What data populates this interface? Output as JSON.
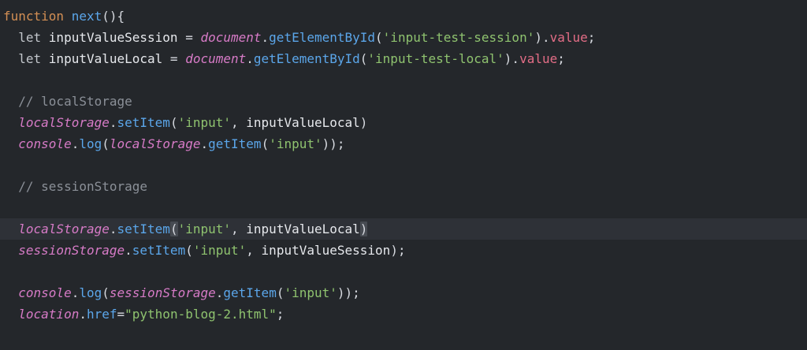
{
  "editor": {
    "theme_colors": {
      "background": "#24272b",
      "active_line": "#2e3137",
      "keyword": "#d38f54",
      "function": "#5ba6ea",
      "builtin_italic": "#d77bc7",
      "string": "#8fc36f",
      "comment": "#8b9098"
    },
    "active_line_index": 10,
    "lines": [
      {
        "tokens": [
          {
            "t": "function ",
            "c": "keyword"
          },
          {
            "t": "next",
            "c": "func"
          },
          {
            "t": "(){",
            "c": "punct"
          }
        ]
      },
      {
        "tokens": [
          {
            "t": "  let ",
            "c": "let"
          },
          {
            "t": "inputValueSession",
            "c": "ident"
          },
          {
            "t": " = ",
            "c": "punct"
          },
          {
            "t": "document",
            "c": "italic"
          },
          {
            "t": ".",
            "c": "punct"
          },
          {
            "t": "getElementById",
            "c": "func"
          },
          {
            "t": "(",
            "c": "punct"
          },
          {
            "t": "'input-test-session'",
            "c": "string"
          },
          {
            "t": ").",
            "c": "punct"
          },
          {
            "t": "value",
            "c": "prop"
          },
          {
            "t": ";",
            "c": "punct"
          }
        ]
      },
      {
        "tokens": [
          {
            "t": "  let ",
            "c": "let"
          },
          {
            "t": "inputValueLocal",
            "c": "ident"
          },
          {
            "t": " = ",
            "c": "punct"
          },
          {
            "t": "document",
            "c": "italic"
          },
          {
            "t": ".",
            "c": "punct"
          },
          {
            "t": "getElementById",
            "c": "func"
          },
          {
            "t": "(",
            "c": "punct"
          },
          {
            "t": "'input-test-local'",
            "c": "string"
          },
          {
            "t": ").",
            "c": "punct"
          },
          {
            "t": "value",
            "c": "prop"
          },
          {
            "t": ";",
            "c": "punct"
          }
        ]
      },
      {
        "tokens": []
      },
      {
        "tokens": [
          {
            "t": "  // localStorage",
            "c": "comment"
          }
        ]
      },
      {
        "tokens": [
          {
            "t": "  ",
            "c": "punct"
          },
          {
            "t": "localStorage",
            "c": "italic"
          },
          {
            "t": ".",
            "c": "punct"
          },
          {
            "t": "setItem",
            "c": "func"
          },
          {
            "t": "(",
            "c": "punct"
          },
          {
            "t": "'input'",
            "c": "string"
          },
          {
            "t": ", ",
            "c": "punct"
          },
          {
            "t": "inputValueLocal",
            "c": "ident"
          },
          {
            "t": ")",
            "c": "punct"
          }
        ]
      },
      {
        "tokens": [
          {
            "t": "  ",
            "c": "punct"
          },
          {
            "t": "console",
            "c": "italic"
          },
          {
            "t": ".",
            "c": "punct"
          },
          {
            "t": "log",
            "c": "func"
          },
          {
            "t": "(",
            "c": "punct"
          },
          {
            "t": "localStorage",
            "c": "italic"
          },
          {
            "t": ".",
            "c": "punct"
          },
          {
            "t": "getItem",
            "c": "func"
          },
          {
            "t": "(",
            "c": "punct"
          },
          {
            "t": "'input'",
            "c": "string"
          },
          {
            "t": "));",
            "c": "punct"
          }
        ]
      },
      {
        "tokens": []
      },
      {
        "tokens": [
          {
            "t": "  // sessionStorage",
            "c": "comment"
          }
        ]
      },
      {
        "tokens": []
      },
      {
        "tokens": [
          {
            "t": "  ",
            "c": "punct"
          },
          {
            "t": "localStorage",
            "c": "italic"
          },
          {
            "t": ".",
            "c": "punct"
          },
          {
            "t": "setItem",
            "c": "func"
          },
          {
            "t": "(",
            "c": "punct",
            "hl": true
          },
          {
            "t": "'input'",
            "c": "string"
          },
          {
            "t": ", ",
            "c": "punct"
          },
          {
            "t": "inputValueLocal",
            "c": "ident"
          },
          {
            "t": ")",
            "c": "punct",
            "hl": true
          }
        ]
      },
      {
        "tokens": [
          {
            "t": "  ",
            "c": "punct"
          },
          {
            "t": "sessionStorage",
            "c": "italic"
          },
          {
            "t": ".",
            "c": "punct"
          },
          {
            "t": "setItem",
            "c": "func"
          },
          {
            "t": "(",
            "c": "punct"
          },
          {
            "t": "'input'",
            "c": "string"
          },
          {
            "t": ", ",
            "c": "punct"
          },
          {
            "t": "inputValueSession",
            "c": "ident"
          },
          {
            "t": ");",
            "c": "punct"
          }
        ]
      },
      {
        "tokens": []
      },
      {
        "tokens": [
          {
            "t": "  ",
            "c": "punct"
          },
          {
            "t": "console",
            "c": "italic"
          },
          {
            "t": ".",
            "c": "punct"
          },
          {
            "t": "log",
            "c": "func"
          },
          {
            "t": "(",
            "c": "punct"
          },
          {
            "t": "sessionStorage",
            "c": "italic"
          },
          {
            "t": ".",
            "c": "punct"
          },
          {
            "t": "getItem",
            "c": "func"
          },
          {
            "t": "(",
            "c": "punct"
          },
          {
            "t": "'input'",
            "c": "string"
          },
          {
            "t": "));",
            "c": "punct"
          }
        ]
      },
      {
        "tokens": [
          {
            "t": "  ",
            "c": "punct"
          },
          {
            "t": "location",
            "c": "italic"
          },
          {
            "t": ".",
            "c": "punct"
          },
          {
            "t": "href",
            "c": "func"
          },
          {
            "t": "=",
            "c": "punct"
          },
          {
            "t": "\"python-blog-2.html\"",
            "c": "string"
          },
          {
            "t": ";",
            "c": "punct"
          }
        ]
      }
    ]
  }
}
